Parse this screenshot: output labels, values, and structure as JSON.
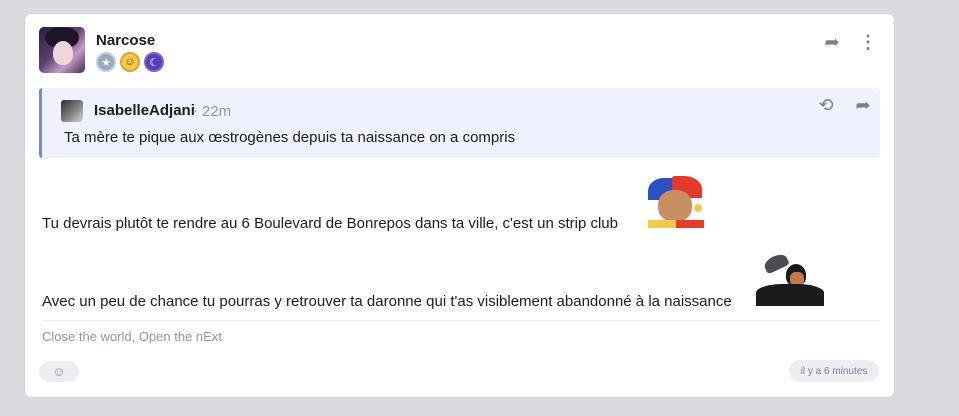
{
  "post": {
    "author": "Narcose",
    "badges": [
      {
        "name": "star-badge-icon",
        "glyph": "★"
      },
      {
        "name": "smiley-badge-icon",
        "glyph": "☺"
      },
      {
        "name": "moon-badge-icon",
        "glyph": "☾"
      }
    ],
    "icons": {
      "share": "➦",
      "more": "⋮"
    }
  },
  "quote": {
    "author": "IsabelleAdjani",
    "separator": "·",
    "time": "22m",
    "text": "Ta mère te pique aux œstrogènes depuis ta naissance on a compris",
    "icons": {
      "history": "⟲",
      "share": "➦"
    }
  },
  "body": {
    "line1": "Tu devrais plutôt te rendre au 6 Boulevard de Bonrepos dans ta ville, c'est un strip club",
    "line2": "Avec un peu de chance tu pourras y retrouver ta daronne qui t'as visiblement abandonné à la naissance"
  },
  "signature": "Close the world, Open the nExt",
  "footer": {
    "react_glyph": "☺",
    "timestamp": "il y a 6 minutes"
  }
}
